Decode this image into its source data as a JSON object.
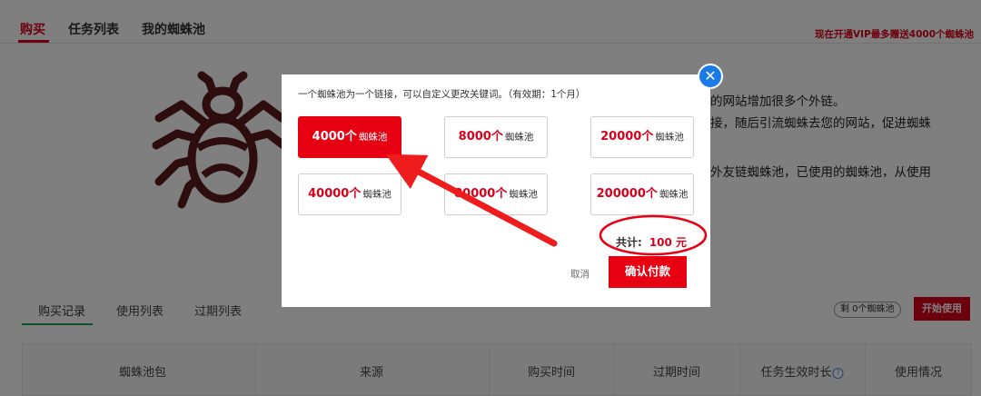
{
  "top_tabs": [
    {
      "label": "购买",
      "active": true
    },
    {
      "label": "任务列表",
      "active": false
    },
    {
      "label": "我的蜘蛛池",
      "active": false
    }
  ],
  "promo_text": "现在开通VIP最多赠送4000个蜘蛛池",
  "background_text": {
    "line1": "的网站增加很多个外链。",
    "line2": "接，随后引流蜘蛛去您的网站，促进蜘蛛",
    "line3": "外友链蜘蛛池，已使用的蜘蛛池，从使用"
  },
  "sub_tabs": [
    {
      "label": "购买记录",
      "active": true
    },
    {
      "label": "使用列表",
      "active": false
    },
    {
      "label": "过期列表",
      "active": false
    }
  ],
  "remain_badge": "剩 0个蜘蛛池",
  "start_button": "开始使用",
  "table_headers": [
    "蜘蛛池包",
    "来源",
    "购买时间",
    "过期时间",
    "任务生效时长",
    "使用情况"
  ],
  "modal": {
    "description": "一个蜘蛛池为一个链接，可以自定义更改关键词。（有效期：1个月）",
    "packages": [
      {
        "count": "4000个",
        "unit": "蜘蛛池",
        "selected": true
      },
      {
        "count": "8000个",
        "unit": "蜘蛛池",
        "selected": false
      },
      {
        "count": "20000个",
        "unit": "蜘蛛池",
        "selected": false
      },
      {
        "count": "40000个",
        "unit": "蜘蛛池",
        "selected": false
      },
      {
        "count": "80000个",
        "unit": "蜘蛛池",
        "selected": false
      },
      {
        "count": "200000个",
        "unit": "蜘蛛池",
        "selected": false
      }
    ],
    "total_label": "共计:",
    "total_amount": "100 元",
    "cancel_label": "取消",
    "confirm_label": "确认付款",
    "close_icon": "close-icon"
  },
  "help_icon_glyph": "?",
  "colors": {
    "accent_red": "#e60012",
    "close_blue": "#1b7be6",
    "tab_green": "#1aa35b"
  }
}
